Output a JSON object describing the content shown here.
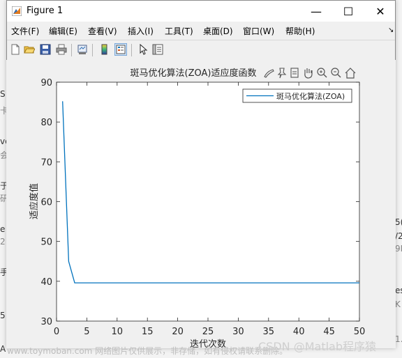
{
  "window": {
    "title": "Figure 1",
    "minimize": "—",
    "maximize": "☐",
    "close": "✕"
  },
  "menu": [
    "文件(F)",
    "编辑(E)",
    "查看(V)",
    "插入(I)",
    "工具(T)",
    "桌面(D)",
    "窗口(W)",
    "帮助(H)"
  ],
  "toolbar_icons": [
    "new-figure-icon",
    "open-file-icon",
    "save-icon",
    "print-icon",
    "link-icon",
    "colorbar-icon",
    "legend-icon",
    "pointer-icon",
    "property-editor-icon"
  ],
  "axes_toolbar_icons": [
    "brush-icon",
    "datatip-icon",
    "rotate-icon",
    "pan-icon",
    "zoom-in-icon",
    "zoom-out-icon",
    "home-icon"
  ],
  "background_fragments": {
    "left": [
      "S",
      "ve",
      "于",
      "e",
      "手",
      "5",
      "A"
    ],
    "left_muted": [
      "卡",
      "会",
      "研",
      "2"
    ],
    "right": [
      "5(",
      "/2",
      "es"
    ],
    "right_muted": [
      "9K",
      "K",
      "1.0K"
    ]
  },
  "watermarks": {
    "left": "www.toymoban.com 网络图片仅供展示，非存储，如有侵权请联系删除。",
    "right": "CSDN @Matlab程序猿"
  },
  "colors": {
    "series": "#0072BD",
    "axes_bg": "#ffffff",
    "figure_bg": "#f0f0f0"
  },
  "chart_data": {
    "type": "line",
    "title": "斑马优化算法(ZOA)适应度函数",
    "xlabel": "迭代次数",
    "ylabel": "适应度值",
    "xlim": [
      0,
      50
    ],
    "ylim": [
      30,
      90
    ],
    "xticks": [
      0,
      5,
      10,
      15,
      20,
      25,
      30,
      35,
      40,
      45,
      50
    ],
    "yticks": [
      30,
      40,
      50,
      60,
      70,
      80,
      90
    ],
    "legend_position": "top-right",
    "grid": false,
    "series": [
      {
        "name": "斑马优化算法(ZOA)",
        "x": [
          1,
          2,
          3,
          4,
          5,
          10,
          15,
          20,
          25,
          30,
          35,
          40,
          45,
          50
        ],
        "y": [
          85.2,
          45.0,
          39.6,
          39.6,
          39.6,
          39.6,
          39.6,
          39.6,
          39.6,
          39.6,
          39.6,
          39.6,
          39.6,
          39.6
        ]
      }
    ]
  }
}
